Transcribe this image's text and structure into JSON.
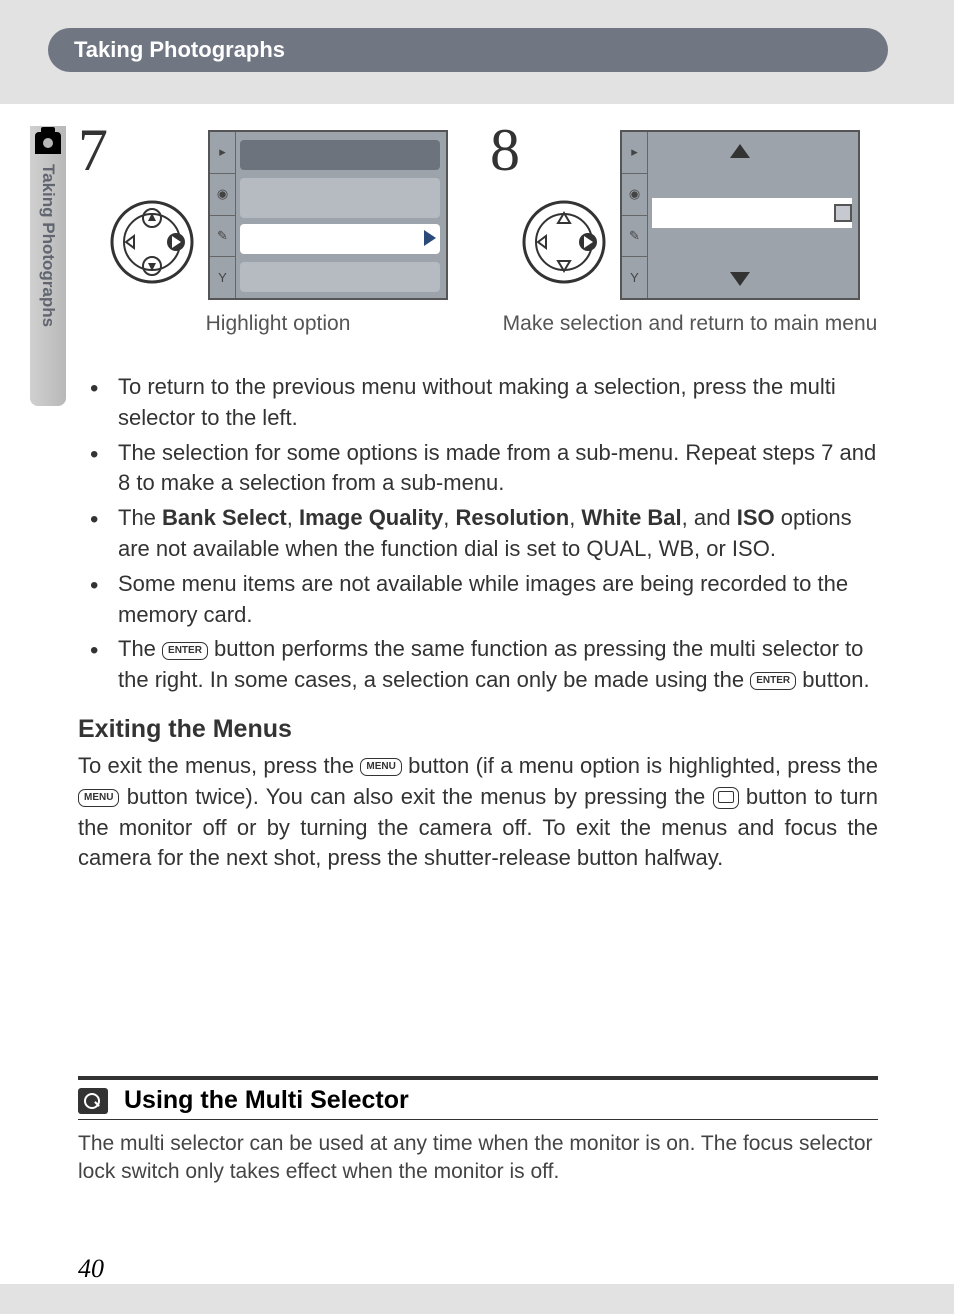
{
  "header": {
    "title": "Taking Photographs"
  },
  "sidebar": {
    "label": "Taking Photographs"
  },
  "steps": {
    "s7": {
      "num": "7",
      "caption": "Highlight option"
    },
    "s8": {
      "num": "8",
      "caption": "Make selection and return to main menu"
    }
  },
  "bullets": [
    "To return to the previous menu without making a selection, press the multi selector to the left.",
    "The selection for some options is made from a sub-menu.  Repeat steps 7 and 8 to make a selection from a sub-menu.",
    "",
    "Some menu items are not available while images are being recorded to the memory card.",
    ""
  ],
  "bullet3": {
    "pre": "The ",
    "b1": "Bank Select",
    "sep1": ", ",
    "b2": "Image Quality",
    "sep2": ", ",
    "b3": "Resolution",
    "sep3": ",  ",
    "b4": "White Bal",
    "sep4": ", and ",
    "b5": "ISO",
    "post1": " options are not available when the function dial is set to ",
    "d1": "QUAL",
    "d2": "WB",
    "d3": "ISO",
    "end": "."
  },
  "bullet5": {
    "pre": "The ",
    "btn1": "ENTER",
    "mid": " button performs the same function as pressing the multi selector to the right.  In some cases, a selection can only be made using the ",
    "btn2": "ENTER",
    "post": " button."
  },
  "exit": {
    "heading": "Exiting the Menus",
    "p1a": "To exit the menus, press the ",
    "btn_menu": "MENU",
    "p1b": " button (if a menu option is highlighted, press the ",
    "p1c": " button twice).  You can also exit the menus by pressing the ",
    "p1d": " button to turn the monitor off or by turning the camera off.  To exit the menus and focus the camera for the next shot, press the shutter-release button halfway."
  },
  "tip": {
    "title": "Using the Multi Selector",
    "text": "The multi selector can be used at any time when the monitor is on.  The focus selector lock switch only takes effect when the monitor is off."
  },
  "page_number": "40"
}
